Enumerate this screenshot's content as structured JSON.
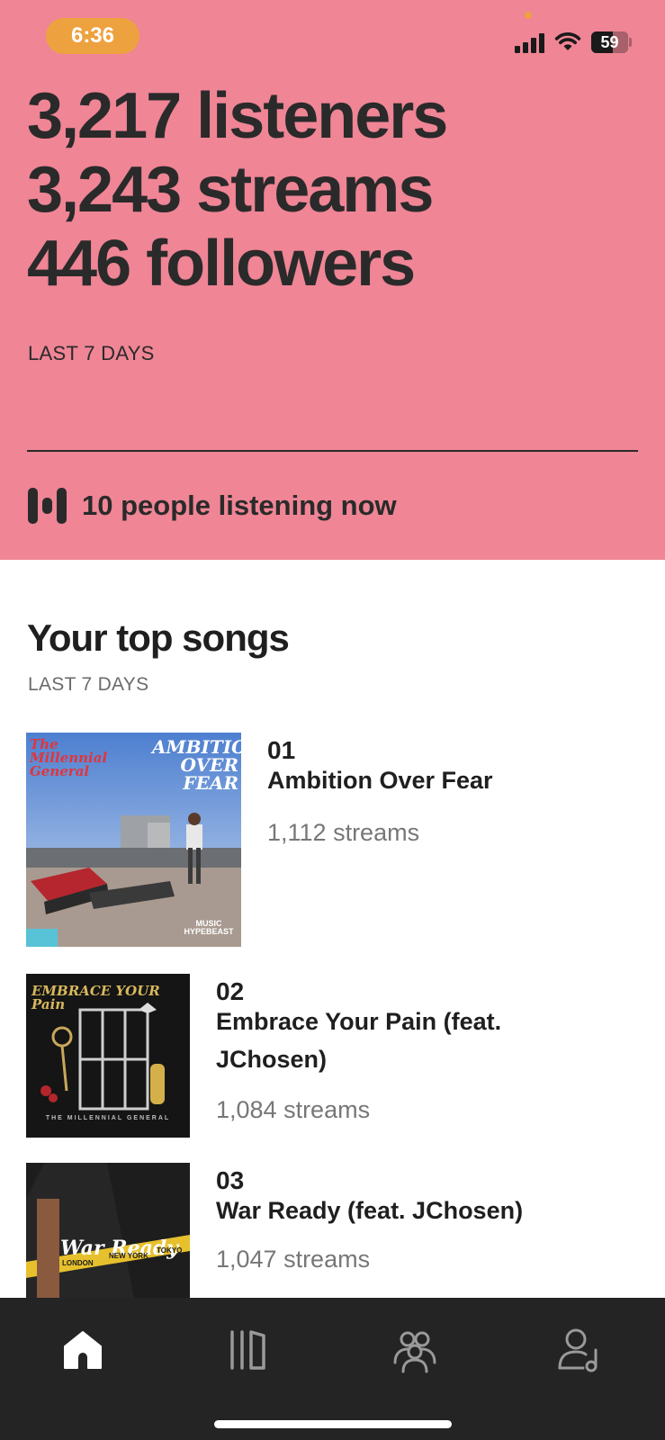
{
  "status_bar": {
    "time": "6:36",
    "battery": "59",
    "battery_level": 0.59
  },
  "overview": {
    "stats": [
      "3,217 listeners",
      "3,243 streams",
      "446 followers"
    ],
    "period": "LAST 7 DAYS",
    "live_listeners": "10 people listening now"
  },
  "top_songs": {
    "title": "Your top songs",
    "period": "LAST 7 DAYS",
    "items": [
      {
        "rank": "01",
        "title": "Ambition Over Fear",
        "streams": "1,112 streams",
        "art_text": [
          "The Millennial General",
          "AMBITION OVER FEAR",
          "MUSIC HYPEBEAST"
        ]
      },
      {
        "rank": "02",
        "title": "Embrace Your Pain (feat. JChosen)",
        "streams": "1,084 streams",
        "art_text": [
          "EMBRACE YOUR Pain",
          "THE MILLENNIAL GENERAL"
        ]
      },
      {
        "rank": "03",
        "title": "War Ready (feat. JChosen)",
        "streams": "1,047 streams",
        "art_text": [
          "War Ready",
          "LONDON",
          "NEW YORK",
          "TOKYO"
        ]
      }
    ]
  },
  "nav": {
    "items": [
      {
        "icon": "home-icon",
        "active": true
      },
      {
        "icon": "music-library-icon",
        "active": false
      },
      {
        "icon": "audience-icon",
        "active": false
      },
      {
        "icon": "profile-icon",
        "active": false
      }
    ]
  },
  "colors": {
    "hero_bg": "#ef8595",
    "time_pill": "#eea23f",
    "nav_bg": "#242424",
    "text_dark": "#2a2a2a",
    "text_muted": "#777777"
  }
}
